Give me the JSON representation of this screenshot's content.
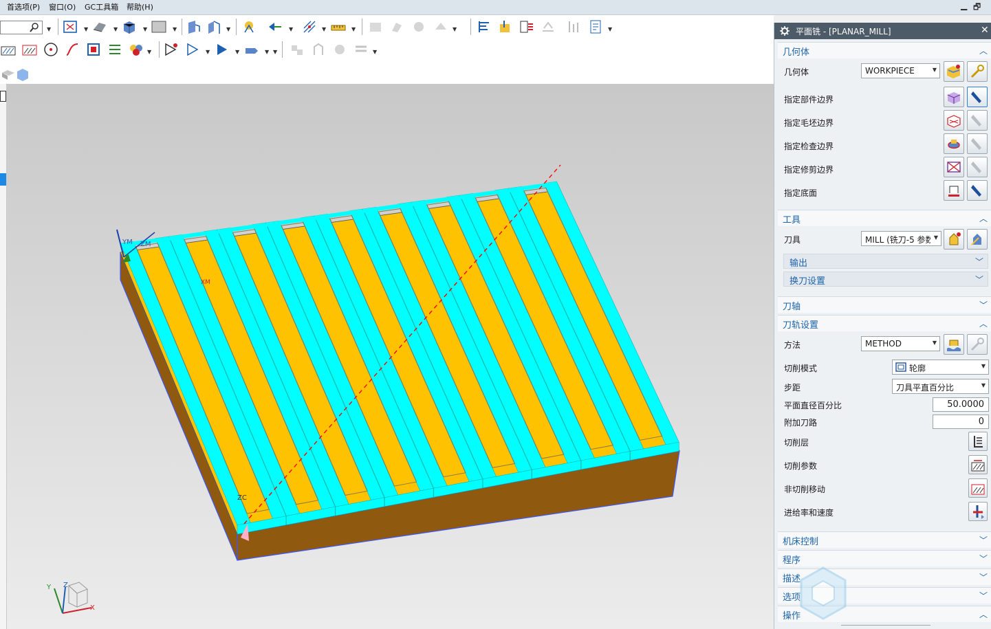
{
  "menu": [
    "首选项(P)",
    "窗口(O)",
    "GC工具箱",
    "帮助(H)"
  ],
  "window_controls": {
    "minimize": "▁",
    "restore": "🗗"
  },
  "viewport": {
    "triad_labels": {
      "x": "X",
      "y": "Y",
      "z": "Z"
    },
    "wcs_labels": {
      "ym": "YM",
      "zm": "ZM",
      "xm": "XM",
      "zc": "ZC"
    }
  },
  "colors": {
    "floor": "#ffc200",
    "walls": "#00ffff",
    "base_side": "#8f5a10",
    "toolpath": "#8a7a4a",
    "tool_axis_line": "#ff0000",
    "title_bar": "#4d5a67",
    "section_text": "#1e64a8"
  },
  "panel": {
    "title": "平面铣 - [PLANAR_MILL]",
    "close": "✕",
    "sections": {
      "geometry": {
        "label": "几何体",
        "geometry_label": "几何体",
        "geometry_value": "WORKPIECE",
        "rows": [
          "指定部件边界",
          "指定毛坯边界",
          "指定检查边界",
          "指定修剪边界",
          "指定底面"
        ]
      },
      "tool": {
        "label": "工具",
        "tool_label": "刀具",
        "tool_value": "MILL (铣刀-5 参数",
        "sub": [
          "输出",
          "换刀设置"
        ]
      },
      "tool_axis": {
        "label": "刀轴"
      },
      "path_settings": {
        "label": "刀轨设置",
        "method_label": "方法",
        "method_value": "METHOD",
        "cut_pattern_label": "切削模式",
        "cut_pattern_value": "轮廓",
        "stepover_label": "步距",
        "stepover_value": "刀具平直百分比",
        "pct_label": "平面直径百分比",
        "pct_value": "50.0000",
        "additional_label": "附加刀路",
        "additional_value": "0",
        "rows": [
          "切削层",
          "切削参数",
          "非切削移动",
          "进给率和速度"
        ]
      },
      "collapsed": [
        "机床控制",
        "程序",
        "描述",
        "选项",
        "操作"
      ]
    }
  }
}
